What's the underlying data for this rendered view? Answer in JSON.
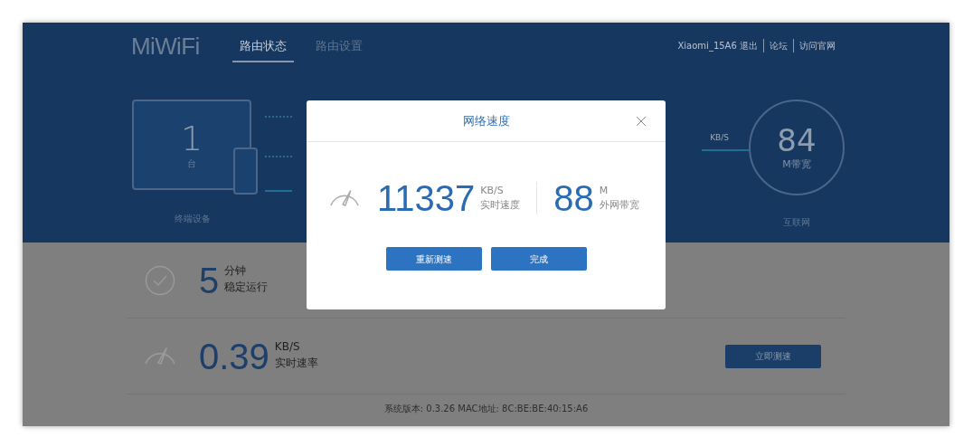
{
  "header": {
    "logo": "MiWiFi",
    "tabs": [
      {
        "label": "路由状态",
        "selected": true
      },
      {
        "label": "路由设置",
        "selected": false
      }
    ],
    "user_links": [
      "Xiaomi_15A6 退出",
      "论坛",
      "访问官网"
    ]
  },
  "topology": {
    "devices": {
      "count": "1",
      "unit": "台",
      "label": "终端设备"
    },
    "speed_unit": "KB/S",
    "internet": {
      "value": "84",
      "unit": "M带宽",
      "label": "互联网"
    }
  },
  "stats": [
    {
      "kind": "uptime",
      "value": "5",
      "unit": "分钟",
      "label": "稳定运行"
    },
    {
      "kind": "speed",
      "value": "0.39",
      "unit": "KB/S",
      "label": "实时速率",
      "button": "立即测速"
    }
  ],
  "footer": "系统版本: 0.3.26  MAC地址: 8C:BE:BE:40:15:A6",
  "dialog": {
    "title": "网络速度",
    "speed": {
      "value": "11337",
      "unit": "KB/S",
      "label": "实时速度"
    },
    "bandwidth": {
      "value": "88",
      "unit": "M",
      "label": "外网带宽"
    },
    "buttons": [
      "重新测速",
      "完成"
    ]
  }
}
